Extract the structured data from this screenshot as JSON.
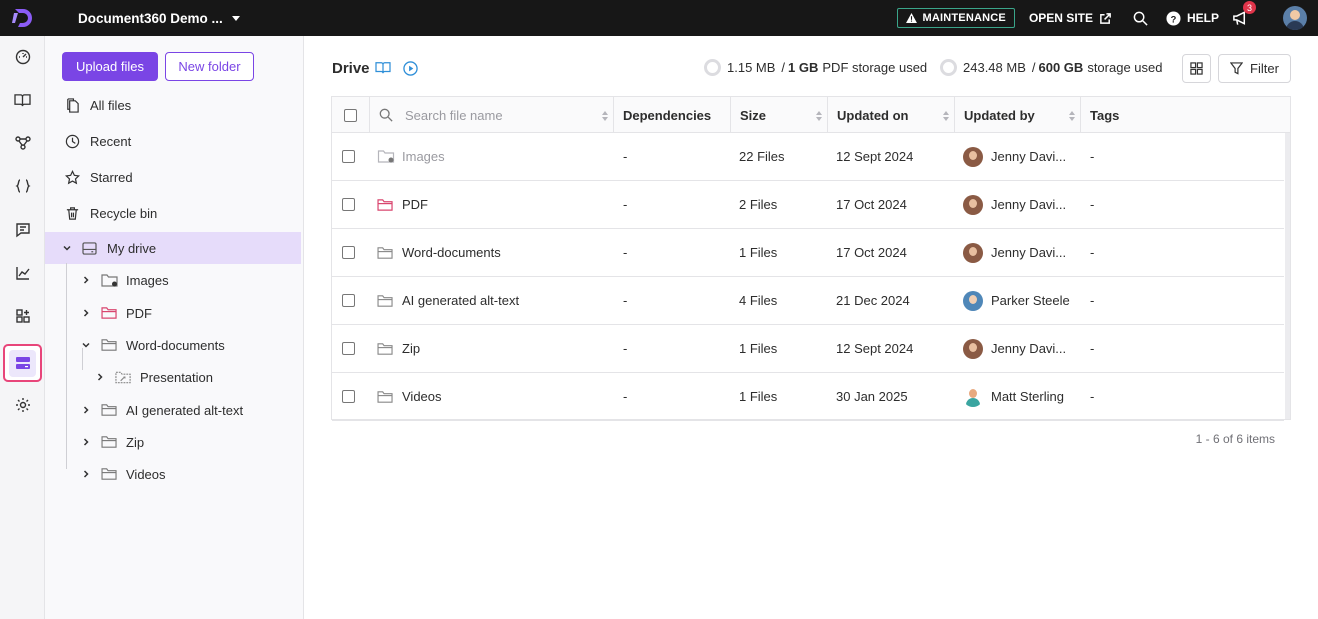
{
  "header": {
    "project_name": "Document360 Demo ...",
    "maintenance_label": "MAINTENANCE",
    "open_site_label": "OPEN SITE",
    "help_label": "HELP",
    "notification_count": "3"
  },
  "rail": {
    "items": [
      "dashboard-icon",
      "documentation-icon",
      "api-docs-icon",
      "code-icon",
      "feedback-icon",
      "analytics-icon",
      "integrations-icon",
      "drive-icon",
      "settings-icon"
    ],
    "active": "drive-icon",
    "active_color": "#e8457a"
  },
  "panel": {
    "upload_label": "Upload files",
    "new_folder_label": "New folder",
    "nav": [
      {
        "label": "All files",
        "icon": "files-icon"
      },
      {
        "label": "Recent",
        "icon": "clock-icon"
      },
      {
        "label": "Starred",
        "icon": "star-icon"
      },
      {
        "label": "Recycle bin",
        "icon": "trash-icon"
      }
    ],
    "my_drive_label": "My drive",
    "tree": [
      {
        "label": "Images"
      },
      {
        "label": "PDF"
      },
      {
        "label": "Word-documents"
      },
      {
        "label": "Presentation"
      },
      {
        "label": "AI generated alt-text"
      },
      {
        "label": "Zip"
      },
      {
        "label": "Videos"
      }
    ]
  },
  "main": {
    "title": "Drive",
    "pdf_storage": {
      "used": "1.15 MB",
      "separator": "/",
      "total": "1 GB",
      "suffix": "PDF storage used"
    },
    "storage": {
      "used": "243.48 MB",
      "separator": "/",
      "total": "600 GB",
      "suffix": "storage used"
    },
    "filter_label": "Filter",
    "accent": "#7a45e5"
  },
  "table": {
    "search_placeholder": "Search file name",
    "columns": [
      "Dependencies",
      "Size",
      "Updated on",
      "Updated by",
      "Tags"
    ],
    "rows": [
      {
        "name": "Images",
        "dependencies": "-",
        "size": "22 Files",
        "updated_on": "12 Sept 2024",
        "updated_by": "Jenny Davi...",
        "tags": "-"
      },
      {
        "name": "PDF",
        "dependencies": "-",
        "size": "2 Files",
        "updated_on": "17 Oct 2024",
        "updated_by": "Jenny Davi...",
        "tags": "-"
      },
      {
        "name": "Word-documents",
        "dependencies": "-",
        "size": "1 Files",
        "updated_on": "17 Oct 2024",
        "updated_by": "Jenny Davi...",
        "tags": "-"
      },
      {
        "name": "AI generated alt-text",
        "dependencies": "-",
        "size": "4 Files",
        "updated_on": "21 Dec 2024",
        "updated_by": "Parker Steele",
        "tags": "-"
      },
      {
        "name": "Zip",
        "dependencies": "-",
        "size": "1 Files",
        "updated_on": "12 Sept 2024",
        "updated_by": "Jenny Davi...",
        "tags": "-"
      },
      {
        "name": "Videos",
        "dependencies": "-",
        "size": "1 Files",
        "updated_on": "30 Jan 2025",
        "updated_by": "Matt Sterling",
        "tags": "-"
      }
    ],
    "pagination": "1 - 6 of 6 items"
  }
}
